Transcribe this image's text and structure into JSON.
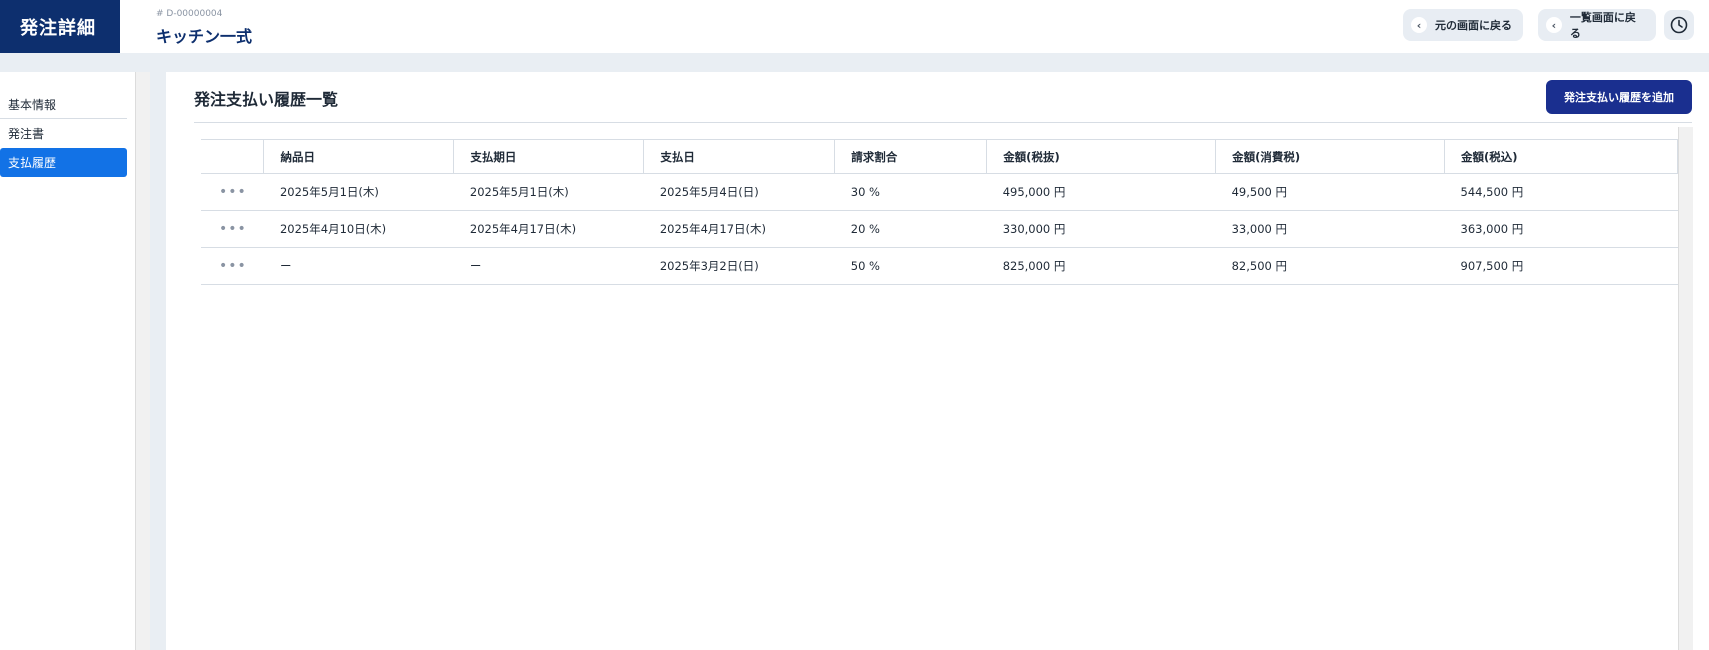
{
  "header": {
    "brand": "発注詳細",
    "record_id": "# D-00000004",
    "record_title": "キッチン一式",
    "back_label": "元の画面に戻る",
    "list_label": "一覧画面に戻る",
    "history_icon": "clock-icon"
  },
  "sidebar": {
    "items": [
      {
        "label": "基本情報",
        "active": false
      },
      {
        "label": "発注書",
        "active": false
      },
      {
        "label": "支払履歴",
        "active": true
      }
    ]
  },
  "main": {
    "title": "発注支払い履歴一覧",
    "add_button": "発注支払い履歴を追加",
    "table": {
      "columns": [
        "",
        "納品日",
        "支払期日",
        "支払日",
        "請求割合",
        "金額(税抜)",
        "金額(消費税)",
        "金額(税込)"
      ],
      "rows": [
        [
          "•••",
          "2025年5月1日(木)",
          "2025年5月1日(木)",
          "2025年5月4日(日)",
          "30 %",
          "495,000 円",
          "49,500 円",
          "544,500 円"
        ],
        [
          "•••",
          "2025年4月10日(木)",
          "2025年4月17日(木)",
          "2025年4月17日(木)",
          "20 %",
          "330,000 円",
          "33,000 円",
          "363,000 円"
        ],
        [
          "•••",
          "ー",
          "ー",
          "2025年3月2日(日)",
          "50 %",
          "825,000 円",
          "82,500 円",
          "907,500 円"
        ]
      ]
    }
  },
  "colors": {
    "brand": "#0d2f6e",
    "active_nav": "#1272e6",
    "primary_button": "#1a2f8f"
  }
}
